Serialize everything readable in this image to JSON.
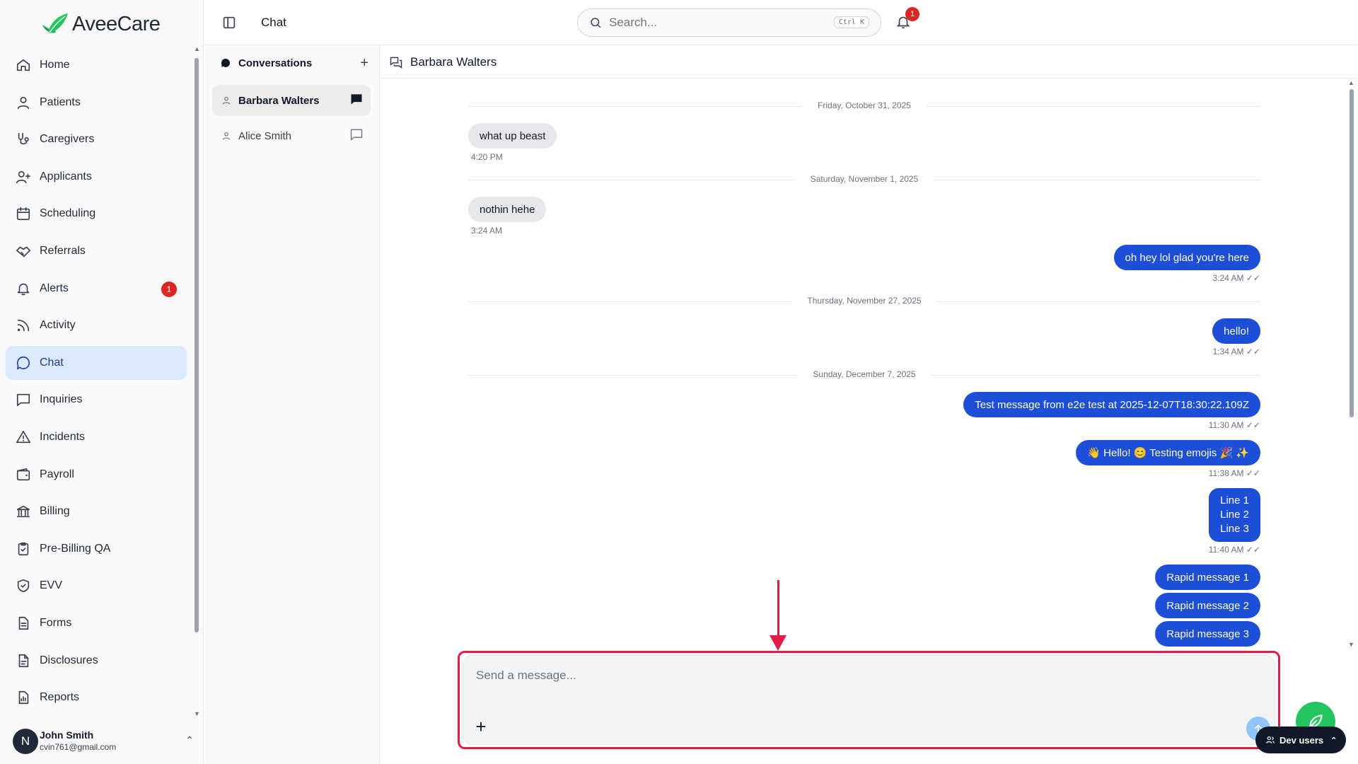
{
  "app": {
    "name": "AveeCare"
  },
  "nav": {
    "items": [
      {
        "label": "Home",
        "icon": "home-icon"
      },
      {
        "label": "Patients",
        "icon": "user-icon"
      },
      {
        "label": "Caregivers",
        "icon": "stethoscope-icon"
      },
      {
        "label": "Applicants",
        "icon": "user-plus-icon"
      },
      {
        "label": "Scheduling",
        "icon": "calendar-icon"
      },
      {
        "label": "Referrals",
        "icon": "handshake-icon"
      },
      {
        "label": "Alerts",
        "icon": "bell-icon",
        "badge": "1"
      },
      {
        "label": "Activity",
        "icon": "rss-icon"
      },
      {
        "label": "Chat",
        "icon": "chat-bubble-icon",
        "active": true
      },
      {
        "label": "Inquiries",
        "icon": "message-square-icon"
      },
      {
        "label": "Incidents",
        "icon": "warning-triangle-icon"
      },
      {
        "label": "Payroll",
        "icon": "wallet-icon"
      },
      {
        "label": "Billing",
        "icon": "bank-icon"
      },
      {
        "label": "Pre-Billing QA",
        "icon": "clipboard-check-icon"
      },
      {
        "label": "EVV",
        "icon": "shield-check-icon"
      },
      {
        "label": "Forms",
        "icon": "document-icon"
      },
      {
        "label": "Disclosures",
        "icon": "file-text-icon"
      },
      {
        "label": "Reports",
        "icon": "report-icon"
      }
    ]
  },
  "user": {
    "initial": "N",
    "name": "John Smith",
    "email": "cvin761@gmail.com"
  },
  "topbar": {
    "title": "Chat",
    "search_placeholder": "Search...",
    "shortcut": "Ctrl K",
    "notification_count": "1"
  },
  "conversations": {
    "title": "Conversations",
    "items": [
      {
        "name": "Barbara Walters",
        "active": true
      },
      {
        "name": "Alice Smith",
        "active": false
      }
    ]
  },
  "chat": {
    "header": "Barbara Walters",
    "dates": [
      "Friday, October 31, 2025",
      "Saturday, November 1, 2025",
      "Thursday, November 27, 2025",
      "Sunday, December 7, 2025"
    ],
    "messages": [
      {
        "text": "what up beast",
        "time": "4:20 PM",
        "dir": "in"
      },
      {
        "text": "nothin hehe",
        "time": "3:24 AM",
        "dir": "in"
      },
      {
        "text": "oh hey lol glad you're here",
        "time": "3:24 AM ✓✓",
        "dir": "out"
      },
      {
        "text": "hello!",
        "time": "1:34 AM ✓✓",
        "dir": "out"
      },
      {
        "text": "Test message from e2e test at 2025-12-07T18:30:22.109Z",
        "time": "11:30 AM ✓✓",
        "dir": "out"
      },
      {
        "text": "👋 Hello! 😊 Testing emojis 🎉 ✨",
        "time": "11:38 AM ✓✓",
        "dir": "out"
      },
      {
        "lines": [
          "Line 1",
          "Line 2",
          "Line 3"
        ],
        "time": "11:40 AM ✓✓",
        "dir": "out"
      },
      {
        "text": "Rapid message 1",
        "dir": "out"
      },
      {
        "text": "Rapid message 2",
        "dir": "out"
      },
      {
        "text": "Rapid message 3",
        "dir": "out"
      }
    ],
    "composer_placeholder": "Send a message..."
  },
  "dev_users": {
    "label": "Dev users"
  },
  "colors": {
    "accent": "#1d4ed8",
    "highlight": "#e11d48",
    "active_nav": "#dbeafe",
    "badge": "#dc2626",
    "fab": "#22c55e"
  }
}
